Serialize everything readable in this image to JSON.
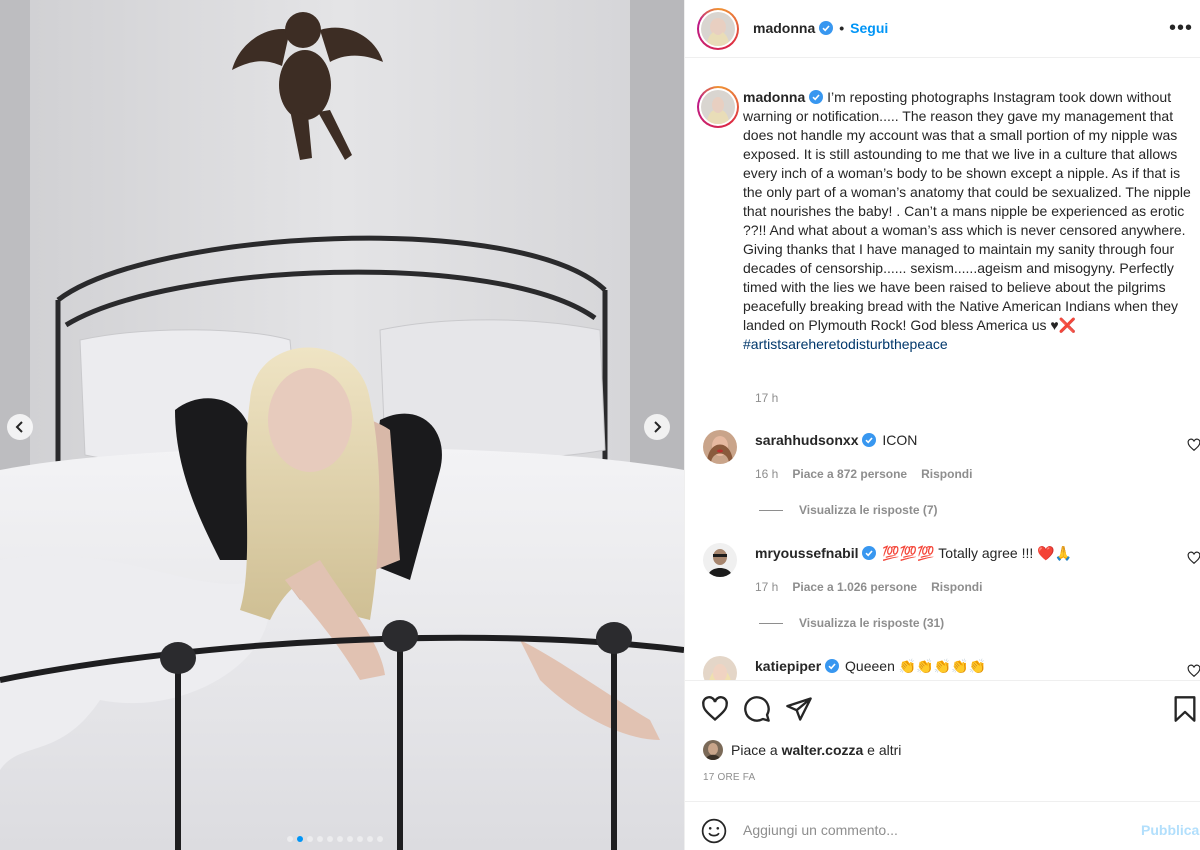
{
  "post": {
    "username": "madonna",
    "follow_label": "Segui",
    "header_dot": "•",
    "more_label": "•••",
    "carousel": {
      "total": 10,
      "active_index": 1
    }
  },
  "caption": {
    "username": "madonna",
    "text": "I’m reposting photographs Instagram took down without warning or notification..... The reason they gave my management that does not handle my account was that a small portion of my nipple was exposed. It is still astounding to me that we live in a culture that allows every inch of a woman’s body to be shown except a nipple. As if that is the only part of a woman’s anatomy that could be sexualized. The nipple that nourishes the baby! . Can’t a mans nipple be experienced as erotic ??!! And what about a woman’s ass which is never censored anywhere. Giving thanks that I have managed to maintain my sanity through four decades of censorship...... sexism......ageism and misogyny. Perfectly timed with the lies we have been raised to believe about the pilgrims peacefully breaking bread with the Native American Indians when they landed on Plymouth Rock! God bless America us ♥❌ ",
    "hashtag": "#artistsareheretodisturbthepeace",
    "time": "17 h"
  },
  "comments": [
    {
      "username": "sarahhudsonxx",
      "verified": true,
      "text": "ICON",
      "time": "16 h",
      "likes": "Piace a 872 persone",
      "reply_label": "Rispondi",
      "replies": "Visualizza le risposte (7)"
    },
    {
      "username": "mryoussefnabil",
      "verified": true,
      "text": "💯💯💯 Totally agree !!! ❤️🙏",
      "time": "17 h",
      "likes": "Piace a 1.026 persone",
      "reply_label": "Rispondi",
      "replies": "Visualizza le risposte (31)"
    },
    {
      "username": "katiepiper",
      "verified": true,
      "text": "Queeen 👏👏👏👏👏"
    }
  ],
  "actions": {
    "likes_prefix": "Piace a ",
    "likes_user": "walter.cozza",
    "likes_suffix": " e altri",
    "date": "17 ORE FA"
  },
  "add_comment": {
    "placeholder": "Aggiungi un commento...",
    "publish_label": "Pubblica"
  },
  "colors": {
    "accent": "#0095f6",
    "verified": "#3897f0",
    "hashtag": "#00376b",
    "muted": "#8e8e8e",
    "publish_disabled": "#b2dffc"
  }
}
